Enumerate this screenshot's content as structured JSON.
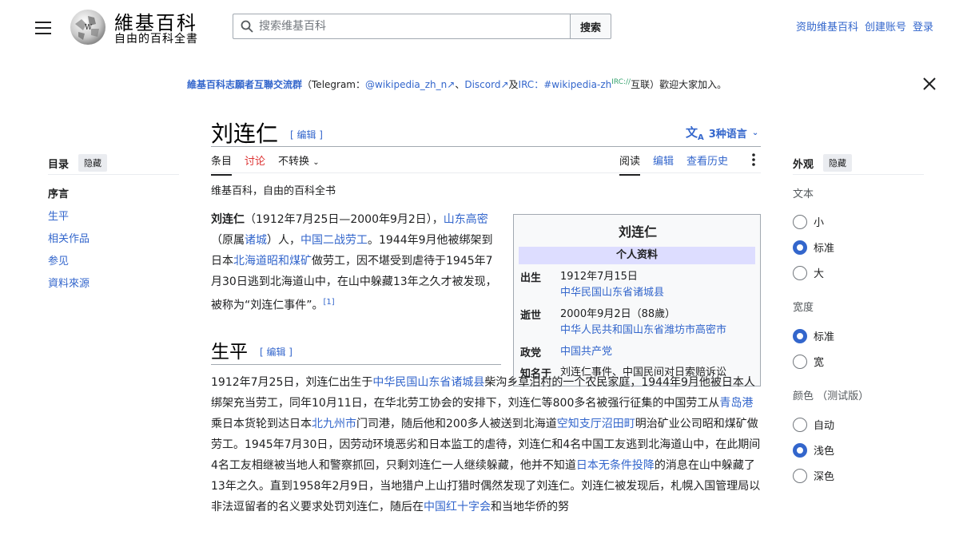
{
  "header": {
    "site_title": "維基百科",
    "tagline": "自由的百科全書",
    "search_placeholder": "搜索维基百科",
    "search_button": "搜索",
    "top_links": [
      "资助维基百科",
      "创建账号",
      "登录"
    ]
  },
  "banner": {
    "strong": "維基百科志願者互聯交流群",
    "open": "（Telegram：",
    "tg": "@wikipedia_zh_n",
    "sep1": "、",
    "discord": "Discord",
    "and": "及",
    "irc": "IRC：",
    "irc_chan": "#wikipedia-zh",
    "irc_sup": "IRC://",
    "end": "互联）歡迎大家加入。"
  },
  "title": {
    "text": "刘连仁",
    "edit": "[ 编辑 ]",
    "lang": "3种语言"
  },
  "tabs_left": [
    "条目",
    "讨论",
    "不转换"
  ],
  "tabs_right": [
    "阅读",
    "编辑",
    "查看历史"
  ],
  "from_text": "维基百科，自由的百科全书",
  "toc": {
    "heading": "目录",
    "hide": "隐藏",
    "items": [
      "序言",
      "生平",
      "相关作品",
      "参见",
      "資料來源"
    ]
  },
  "appearance": {
    "heading": "外观",
    "hide": "隐藏",
    "text_label": "文本",
    "text_options": [
      "小",
      "标准",
      "大"
    ],
    "width_label": "宽度",
    "width_options": [
      "标准",
      "宽"
    ],
    "color_label": "颜色 （测试版）",
    "color_options": [
      "自动",
      "浅色",
      "深色"
    ],
    "selected": {
      "text": "标准",
      "width": "标准",
      "color": "浅色"
    }
  },
  "lead": {
    "name": "刘连仁",
    "p1": "（1912年7月25日—2000年9月2日），",
    "l1": "山东高密",
    "p2": "（原属",
    "l2": "诸城",
    "p3": "）人，",
    "l3": "中国二战劳工",
    "p4": "。1944年9月他被绑架到日本",
    "l4": "北海道昭和煤矿",
    "p5": "做劳工，因不堪受到虐待于1945年7月30日逃到北海道山中，在山中躲藏13年之久才被发现，被称为“刘连仁事件”。",
    "ref": "[1]"
  },
  "section": {
    "title": "生平",
    "edit": "[ 编辑 ]",
    "t1": "1912年7月25日，刘连仁出生于",
    "l1": "中华民国山东省诸城县",
    "t2": "柴沟乡草泊村的一个农民家庭，1944年9月他被日本人绑架充当劳工，同年10月11日，在华北劳工协会的安排下，刘连仁等800多名被强行征集的中国劳工从",
    "l2": "青岛港",
    "t3": "乘日本货轮到达日本",
    "l3": "北九州市",
    "t4": "门司港，随后他和200多人被送到北海道",
    "l4": "空知支厅沼田町",
    "t5": "明治矿业公司昭和煤矿做劳工。1945年7月30日，因劳动环境恶劣和日本监工的虐待，刘连仁和4名中国工友逃到北海道山中，在此期间4名工友相继被当地人和警察抓回，只剩刘连仁一人继续躲藏，他并不知道",
    "l5": "日本无条件投降",
    "t6": "的消息在山中躲藏了13年之久。直到1958年2月9日，当地猎户上山打猎时偶然发现了刘连仁。刘连仁被发现后，札幌入国管理局以非法逗留者的名义要求处罚刘连仁，随后在",
    "l6": "中国红十字会",
    "t7": "和当地华侨的努"
  },
  "infobox": {
    "title": "刘连仁",
    "band": "个人资料",
    "born_k": "出生",
    "born_v1": "1912年7月15日",
    "born_v2": "中华民国山东省诸城县",
    "died_k": "逝世",
    "died_v1": "2000年9月2日（88歲）",
    "died_v2": "中华人民共和国山东省潍坊市高密市",
    "party_k": "政党",
    "party_v": "中国共产党",
    "known_k": "知名于",
    "known_v": "刘连仁事件、中国民间对日索赔诉讼"
  }
}
